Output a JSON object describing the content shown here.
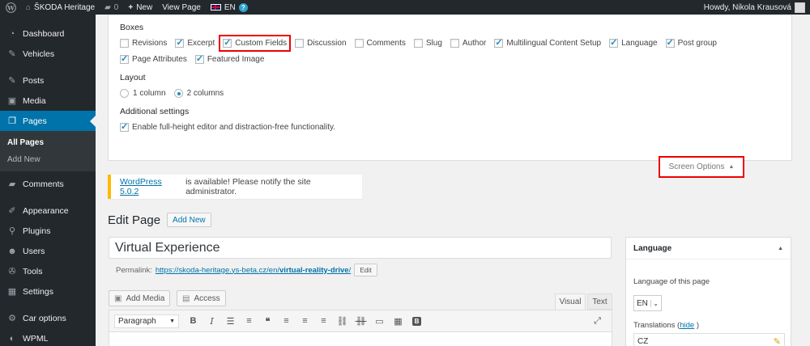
{
  "adminbar": {
    "site_name": "ŠKODA Heritage",
    "comments_count": "0",
    "new_label": "New",
    "view_page_label": "View Page",
    "language": "EN",
    "greeting": "Howdy, Nikola Krausová"
  },
  "sidebar": {
    "items": [
      {
        "label": "Dashboard",
        "icon": "dashboard-icon"
      },
      {
        "label": "Vehicles",
        "icon": "pin-icon"
      },
      {
        "label": "Posts",
        "icon": "pin-icon"
      },
      {
        "label": "Media",
        "icon": "media-icon"
      },
      {
        "label": "Pages",
        "icon": "pages-icon"
      },
      {
        "label": "Comments",
        "icon": "comments-icon"
      },
      {
        "label": "Appearance",
        "icon": "brush-icon"
      },
      {
        "label": "Plugins",
        "icon": "plugin-icon"
      },
      {
        "label": "Users",
        "icon": "users-icon"
      },
      {
        "label": "Tools",
        "icon": "wrench-icon"
      },
      {
        "label": "Settings",
        "icon": "settings-icon"
      },
      {
        "label": "Car options",
        "icon": "gear-icon"
      },
      {
        "label": "WPML",
        "icon": "wpml-icon"
      }
    ],
    "submenu": {
      "all_pages": "All Pages",
      "add_new": "Add New"
    }
  },
  "screen_options": {
    "boxes_heading": "Boxes",
    "boxes": [
      {
        "label": "Revisions",
        "checked": false
      },
      {
        "label": "Excerpt",
        "checked": true
      },
      {
        "label": "Custom Fields",
        "checked": true,
        "highlighted": true
      },
      {
        "label": "Discussion",
        "checked": false
      },
      {
        "label": "Comments",
        "checked": false
      },
      {
        "label": "Slug",
        "checked": false
      },
      {
        "label": "Author",
        "checked": false
      },
      {
        "label": "Multilingual Content Setup",
        "checked": true
      },
      {
        "label": "Language",
        "checked": true
      },
      {
        "label": "Post group",
        "checked": true
      },
      {
        "label": "Page Attributes",
        "checked": true
      },
      {
        "label": "Featured Image",
        "checked": true
      }
    ],
    "layout_heading": "Layout",
    "layout_options": [
      {
        "label": "1 column",
        "checked": false
      },
      {
        "label": "2 columns",
        "checked": true
      }
    ],
    "additional_heading": "Additional settings",
    "additional_option": {
      "label": "Enable full-height editor and distraction-free functionality.",
      "checked": true
    },
    "tab_label": "Screen Options"
  },
  "notice": {
    "link_text": "WordPress 5.0.2",
    "text": "is available! Please notify the site administrator."
  },
  "edit": {
    "heading": "Edit Page",
    "add_new_label": "Add New",
    "title_value": "Virtual Experience",
    "permalink_label": "Permalink:",
    "permalink_base": "https://skoda-heritage.ys-beta.cz/en/",
    "permalink_slug": "virtual-reality-drive",
    "permalink_trailing": "/",
    "permalink_edit_label": "Edit",
    "add_media_label": "Add Media",
    "access_label": "Access",
    "tab_visual": "Visual",
    "tab_text": "Text",
    "format_value": "Paragraph"
  },
  "language_box": {
    "title": "Language",
    "language_of_page_label": "Language of this page",
    "selected_language": "EN",
    "translations_label": "Translations",
    "hide_link": "hide",
    "translation_lang": "CZ"
  },
  "colors": {
    "accent": "#0073aa",
    "highlight": "#e00000",
    "adminbar_bg": "#23282d"
  }
}
